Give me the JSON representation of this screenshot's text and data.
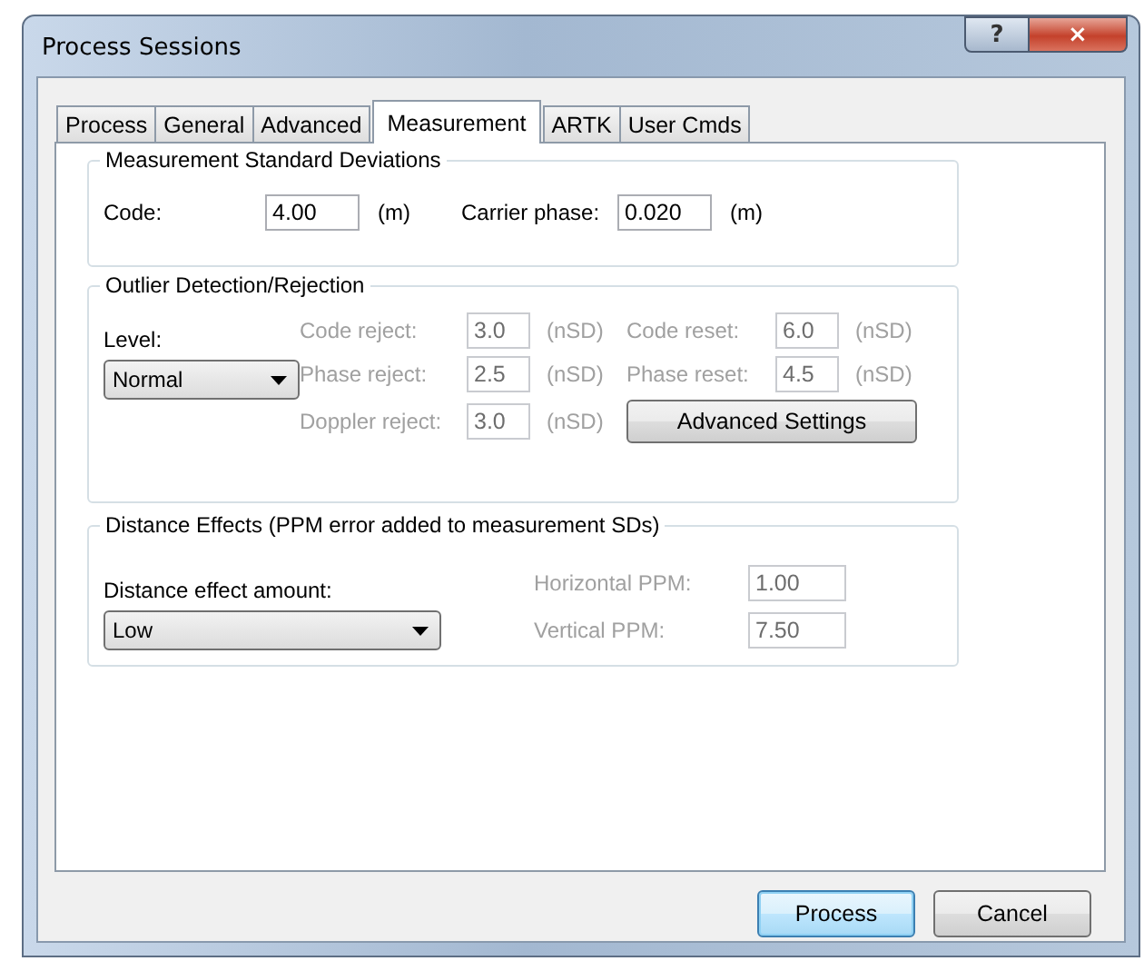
{
  "window": {
    "title": "Process Sessions",
    "help": "?",
    "close": "×"
  },
  "tabs": [
    {
      "label": "Process",
      "selected": false
    },
    {
      "label": "General",
      "selected": false
    },
    {
      "label": "Advanced",
      "selected": false
    },
    {
      "label": "Measurement",
      "selected": true
    },
    {
      "label": "ARTK",
      "selected": false
    },
    {
      "label": "User Cmds",
      "selected": false
    }
  ],
  "std_dev": {
    "title": "Measurement Standard Deviations",
    "fields": [
      {
        "label": "Code:",
        "value": "4.00",
        "unit": "(m)",
        "disabled": false
      },
      {
        "label": "Carrier phase:",
        "value": "0.020",
        "unit": "(m)",
        "disabled": false
      }
    ]
  },
  "outlier": {
    "title": "Outlier Detection/Rejection",
    "level_label": "Level:",
    "level_value": "Normal",
    "fields": [
      {
        "label": "Code reject:",
        "value": "3.0",
        "unit": "(nSD)",
        "disabled": true
      },
      {
        "label": "Code reset:",
        "value": "6.0",
        "unit": "(nSD)",
        "disabled": true
      },
      {
        "label": "Phase reject:",
        "value": "2.5",
        "unit": "(nSD)",
        "disabled": true
      },
      {
        "label": "Phase reset:",
        "value": "4.5",
        "unit": "(nSD)",
        "disabled": true
      },
      {
        "label": "Doppler reject:",
        "value": "3.0",
        "unit": "(nSD)",
        "disabled": true
      }
    ],
    "button": "Advanced Settings"
  },
  "distance": {
    "title": "Distance Effects (PPM error added to measurement SDs)",
    "amount_label": "Distance effect amount:",
    "amount_value": "Low",
    "fields": [
      {
        "label": "Horizontal PPM:",
        "value": "1.00",
        "disabled": true
      },
      {
        "label": "Vertical PPM:",
        "value": "7.50",
        "disabled": true
      }
    ]
  },
  "buttons": [
    {
      "label": "Process",
      "default": true
    },
    {
      "label": "Cancel",
      "default": false
    }
  ]
}
